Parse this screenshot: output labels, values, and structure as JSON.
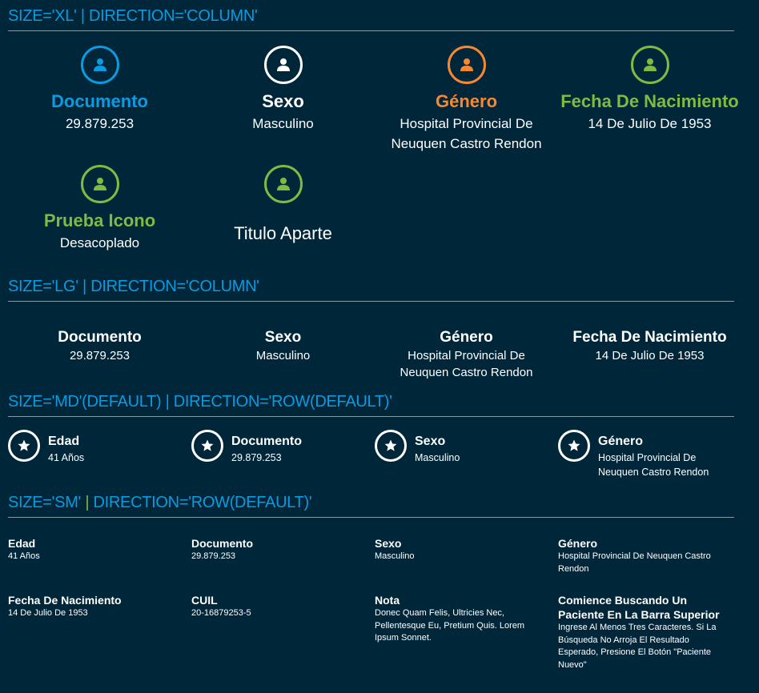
{
  "colors": {
    "background": "#00263a",
    "blue": "#0a9be0",
    "white": "#ffffff",
    "orange": "#f7882f",
    "green": "#7dbb42"
  },
  "sections": [
    {
      "heading_left": "SIZE='XL'",
      "heading_sep": "|",
      "heading_right": "DIRECTION='COLUMN'"
    },
    {
      "heading_left": "SIZE='LG'",
      "heading_sep": "|",
      "heading_right": "DIRECTION='COLUMN'"
    },
    {
      "heading_left": "SIZE='MD'(DEFAULT)",
      "heading_sep": "|",
      "heading_right": "DIRECTION='ROW(DEFAULT)'"
    },
    {
      "heading_left": "SIZE='SM'",
      "heading_sep": "|",
      "heading_right": "DIRECTION='ROW(DEFAULT)'"
    }
  ],
  "xl": [
    {
      "title": "Documento",
      "value": "29.879.253",
      "color": "#0a9be0",
      "icon": "user-icon"
    },
    {
      "title": "Sexo",
      "value": "Masculino",
      "color": "#ffffff",
      "icon": "user-icon"
    },
    {
      "title": "Género",
      "value": "Hospital Provincial De Neuquen Castro Rendon",
      "color": "#f7882f",
      "icon": "user-icon"
    },
    {
      "title": "Fecha De Nacimiento",
      "value": "14 De Julio De 1953",
      "color": "#7dbb42",
      "icon": "user-icon"
    },
    {
      "title": "Prueba Icono",
      "value": "Desacoplado",
      "color": "#7dbb42",
      "icon": "user-icon"
    },
    {
      "title": "Titulo Aparte",
      "icon_color": "#7dbb42",
      "icon": "user-icon"
    }
  ],
  "lg": [
    {
      "title": "Documento",
      "value": "29.879.253"
    },
    {
      "title": "Sexo",
      "value": "Masculino"
    },
    {
      "title": "Género",
      "value": "Hospital Provincial De Neuquen Castro Rendon"
    },
    {
      "title": "Fecha De Nacimiento",
      "value": "14 De Julio De 1953"
    }
  ],
  "md": [
    {
      "title": "Edad",
      "value": "41 Años",
      "icon": "star-icon"
    },
    {
      "title": "Documento",
      "value": "29.879.253",
      "icon": "star-icon"
    },
    {
      "title": "Sexo",
      "value": "Masculino",
      "icon": "star-icon"
    },
    {
      "title": "Género",
      "value": "Hospital Provincial De Neuquen Castro Rendon",
      "icon": "star-icon"
    }
  ],
  "sm": [
    {
      "title": "Edad",
      "value": "41 Años"
    },
    {
      "title": "Documento",
      "value": "29.879.253"
    },
    {
      "title": "Sexo",
      "value": "Masculino"
    },
    {
      "title": "Género",
      "value": "Hospital Provincial De Neuquen Castro Rendon"
    },
    {
      "title": "Fecha De Nacimiento",
      "value": "14 De Julio De 1953"
    },
    {
      "title": "CUIL",
      "value": "20-16879253-5"
    },
    {
      "title": "Nota",
      "value": "Donec Quam Felis, Ultricies Nec, Pellentesque Eu, Pretium Quis. Lorem Ipsum Sonnet."
    },
    {
      "title": "Comience Buscando Un Paciente En La Barra Superior",
      "value": "Ingrese Al Menos Tres Caracteres. Si La Búsqueda No Arroja El Resultado Esperado, Presione El Botón \"Paciente Nuevo\""
    }
  ]
}
